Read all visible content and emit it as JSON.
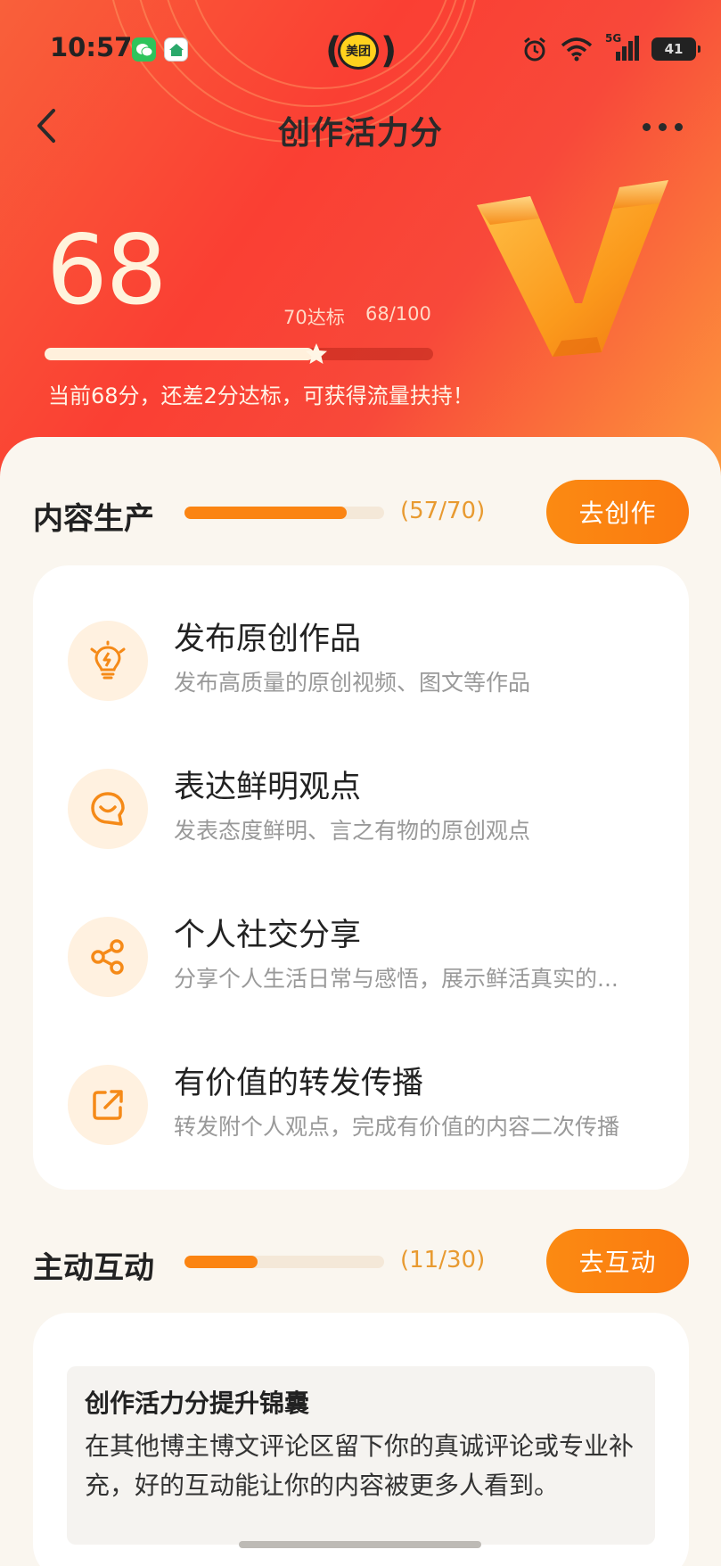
{
  "status_bar": {
    "time": "10:57",
    "meituan_label": "美团",
    "network": "5G",
    "battery": "41"
  },
  "nav": {
    "title": "创作活力分"
  },
  "hero": {
    "score": "68",
    "target_label": "70达标",
    "progress_label": "68/100",
    "progress_value": 68,
    "progress_max": 100,
    "hint": "当前68分，还差2分达标，可获得流量扶持！"
  },
  "content_section": {
    "title": "内容生产",
    "count_label": "(57/70)",
    "progress_value": 57,
    "progress_max": 70,
    "cta": "去创作",
    "tasks": [
      {
        "icon": "lightbulb-icon",
        "title": "发布原创作品",
        "desc": "发布高质量的原创视频、图文等作品"
      },
      {
        "icon": "speech-bubble-icon",
        "title": "表达鲜明观点",
        "desc": "发表态度鲜明、言之有物的原创观点"
      },
      {
        "icon": "share-icon",
        "title": "个人社交分享",
        "desc": "分享个人生活日常与感悟，展示鲜活真实的..."
      },
      {
        "icon": "repost-icon",
        "title": "有价值的转发传播",
        "desc": "转发附个人观点，完成有价值的内容二次传播"
      }
    ]
  },
  "interaction_section": {
    "title": "主动互动",
    "count_label": "(11/30)",
    "progress_value": 11,
    "progress_max": 30,
    "cta": "去互动",
    "tip_title": "创作活力分提升锦囊",
    "tip_body": "在其他博主博文评论区留下你的真诚评论或专业补充，好的互动能让你的内容被更多人看到。"
  },
  "colors": {
    "accent": "#fb8412",
    "hero_red": "#fa3f33",
    "hero_orange": "#fd9b3c"
  }
}
